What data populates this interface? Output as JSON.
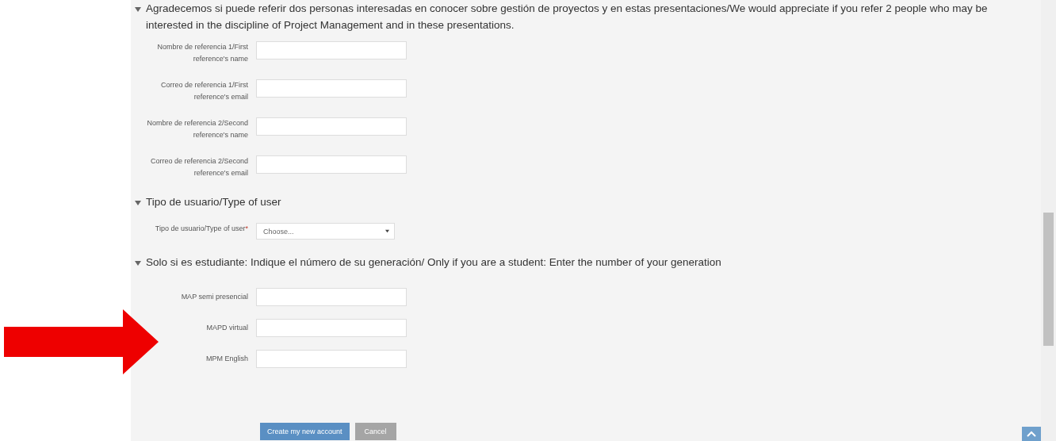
{
  "sections": [
    {
      "legend": "Agradecemos si puede referir dos personas interesadas en conocer sobre gestión de proyectos y en estas presentaciones/We would appreciate if you refer 2 people who may be interested in the discipline of Project Management and in these presentations.",
      "expanded": true,
      "fields": [
        {
          "kind": "text",
          "label": "Nombre de referencia 1/First reference's name"
        },
        {
          "kind": "text",
          "label": "Correo de referencia 1/First reference's email"
        },
        {
          "kind": "text",
          "label": "Nombre de referencia 2/Second reference's name"
        },
        {
          "kind": "text",
          "label": "Correo de referencia 2/Second reference's email"
        }
      ]
    },
    {
      "legend": "Tipo de usuario/Type of user",
      "expanded": true,
      "fields": [
        {
          "kind": "select",
          "label": "Tipo de usuario/Type of user",
          "required_mark": "*",
          "placeholder": "Choose..."
        }
      ]
    },
    {
      "legend": "Solo si es estudiante: Indique el número de su generación/ Only if you are a student: Enter the number of your generation",
      "expanded": true,
      "fields": [
        {
          "kind": "text",
          "label": "MAP semi presencial"
        },
        {
          "kind": "text",
          "label": "MAPD virtual"
        },
        {
          "kind": "text",
          "label": "MPM English"
        }
      ]
    }
  ],
  "buttons": [
    {
      "label": "Create my new account",
      "kind": "primary"
    },
    {
      "label": "Cancel",
      "kind": "secondary"
    }
  ]
}
